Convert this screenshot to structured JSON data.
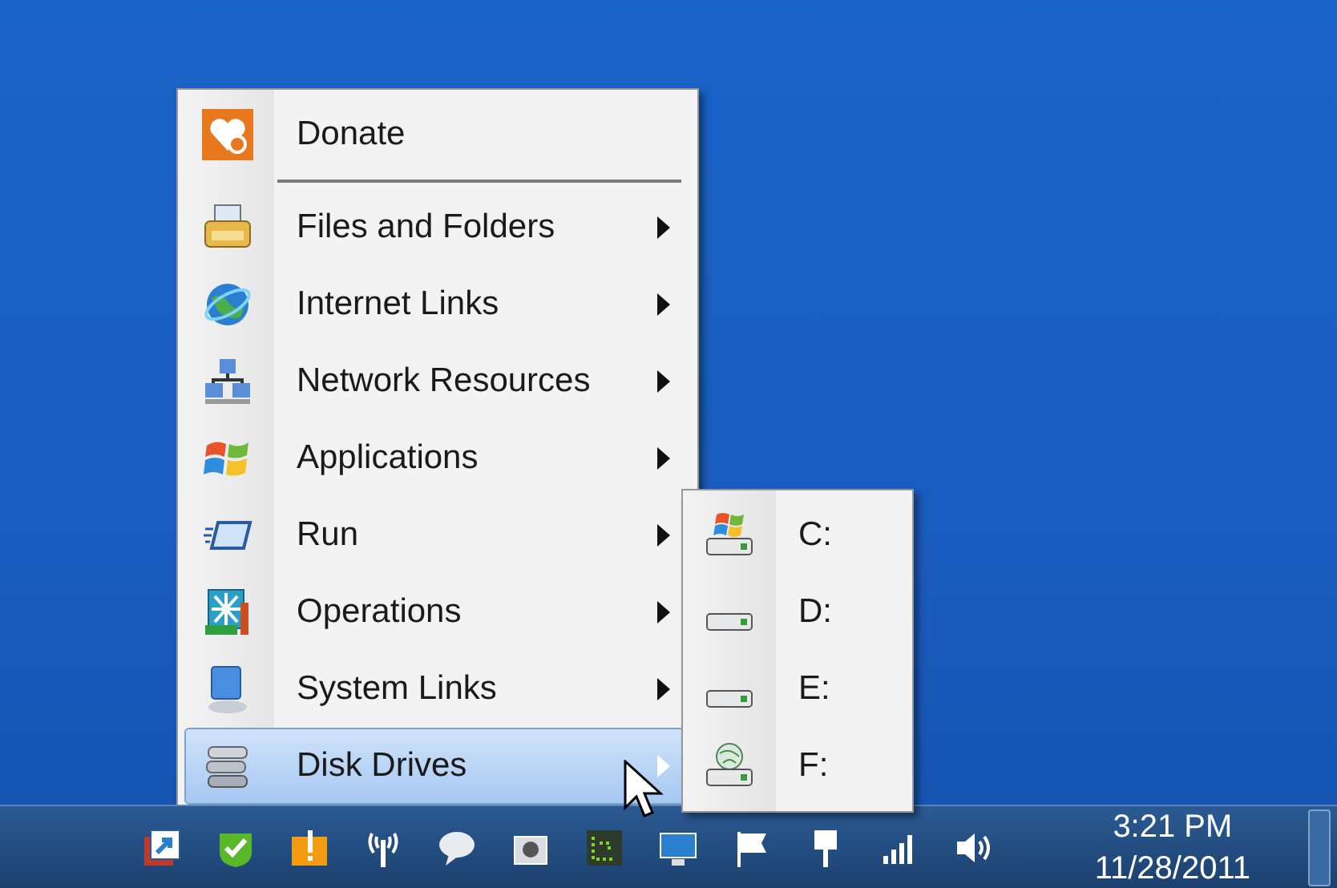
{
  "menu": {
    "items": [
      {
        "label": "Donate",
        "kind": "action",
        "selected": false
      },
      {
        "label": "Files and Folders",
        "kind": "submenu",
        "selected": false
      },
      {
        "label": "Internet Links",
        "kind": "submenu",
        "selected": false
      },
      {
        "label": "Network Resources",
        "kind": "submenu",
        "selected": false
      },
      {
        "label": "Applications",
        "kind": "submenu",
        "selected": false
      },
      {
        "label": "Run",
        "kind": "submenu",
        "selected": false
      },
      {
        "label": "Operations",
        "kind": "submenu",
        "selected": false
      },
      {
        "label": "System Links",
        "kind": "submenu",
        "selected": false
      },
      {
        "label": "Disk Drives",
        "kind": "submenu",
        "selected": true
      }
    ]
  },
  "submenu": {
    "items": [
      {
        "label": "C:",
        "kind": "system"
      },
      {
        "label": "D:",
        "kind": "hdd"
      },
      {
        "label": "E:",
        "kind": "hdd"
      },
      {
        "label": "F:",
        "kind": "network"
      }
    ]
  },
  "taskbar": {
    "clock": {
      "time": "3:21 PM",
      "date": "11/28/2011"
    }
  }
}
